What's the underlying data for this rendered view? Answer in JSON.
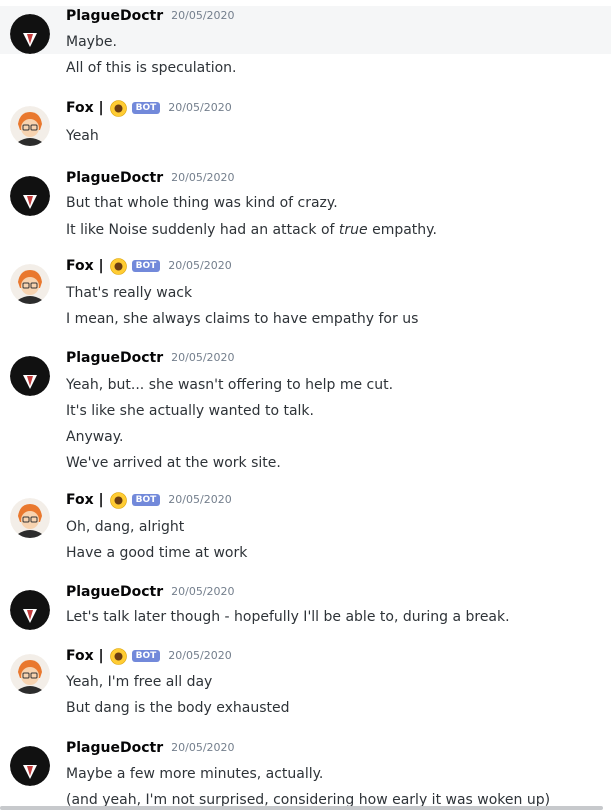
{
  "messages": [
    {
      "author": "PlagueDoctr",
      "timestamp": "20/05/2020",
      "bot": false,
      "lines": [
        "Maybe.",
        "All of this is speculation."
      ]
    },
    {
      "author": "Fox |",
      "timestamp": "20/05/2020",
      "bot": true,
      "bot_label": "BOT",
      "lines": [
        "Yeah"
      ]
    },
    {
      "author": "PlagueDoctr",
      "timestamp": "20/05/2020",
      "bot": false,
      "lines": [
        "But that whole thing was kind of crazy.",
        "It like Noise suddenly had an attack of true empathy."
      ]
    },
    {
      "author": "Fox |",
      "timestamp": "20/05/2020",
      "bot": true,
      "bot_label": "BOT",
      "lines": [
        "That's really wack",
        "I mean, she always claims to have empathy for us"
      ]
    },
    {
      "author": "PlagueDoctr",
      "timestamp": "20/05/2020",
      "bot": false,
      "lines": [
        "Yeah, but... she wasn't offering to help me cut.",
        "It's like she actually wanted to talk.",
        "Anyway.",
        "We've arrived at the work site."
      ]
    },
    {
      "author": "Fox |",
      "timestamp": "20/05/2020",
      "bot": true,
      "bot_label": "BOT",
      "lines": [
        "Oh, dang, alright",
        "Have a good time at work"
      ]
    },
    {
      "author": "PlagueDoctr",
      "timestamp": "20/05/2020",
      "bot": false,
      "lines": [
        "Let's talk later though - hopefully I'll be able to, during a break."
      ]
    },
    {
      "author": "Fox |",
      "timestamp": "20/05/2020",
      "bot": true,
      "bot_label": "BOT",
      "lines": [
        "Yeah, I'm free all day",
        "But dang is the body exhausted"
      ]
    },
    {
      "author": "PlagueDoctr",
      "timestamp": "20/05/2020",
      "bot": false,
      "lines": [
        "Maybe a few more minutes, actually.",
        "(and yeah, I'm not surprised, considering how early it was woken up)"
      ]
    }
  ],
  "colors": {
    "bot_tag": "#7289da",
    "text": "#2e3338",
    "timestamp": "#747f8d",
    "highlight": "#f5f6f7"
  },
  "icons": {
    "plague_avatar": "plague-doctor-avatar",
    "fox_avatar": "fox-avatar",
    "fox_badge": "sunflower-emoji"
  }
}
